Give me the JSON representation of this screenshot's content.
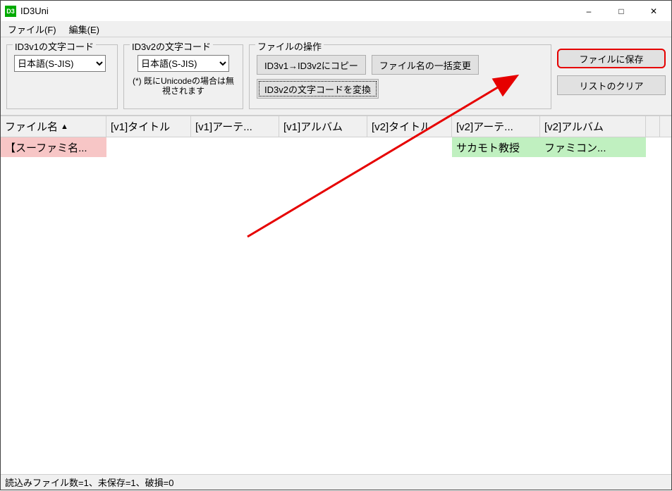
{
  "window": {
    "title": "ID3Uni",
    "icon_text": "D3"
  },
  "menu": {
    "file": "ファイル(F)",
    "edit": "編集(E)"
  },
  "groups": {
    "id3v1_label": "ID3v1の文字コード",
    "id3v2_label": "ID3v2の文字コード",
    "ops_label": "ファイルの操作"
  },
  "encodings": {
    "id3v1_selected": "日本語(S-JIS)",
    "id3v2_selected": "日本語(S-JIS)",
    "id3v2_note": "(*) 既にUnicodeの場合は無視されます"
  },
  "buttons": {
    "copy_v1_to_v2": "ID3v1→ID3v2にコピー",
    "batch_rename": "ファイル名の一括変更",
    "convert_v2_enc": "ID3v2の文字コードを変換",
    "save_to_file": "ファイルに保存",
    "clear_list": "リストのクリア"
  },
  "columns": [
    "ファイル名",
    "[v1]タイトル",
    "[v1]アーテ...",
    "[v1]アルバム",
    "[v2]タイトル",
    "[v2]アーテ...",
    "[v2]アルバム"
  ],
  "sort": {
    "col": 0,
    "dir": "asc",
    "indicator": "▲"
  },
  "rows": [
    {
      "filename": "【スーファミ名...",
      "v1_title": "",
      "v1_artist": "",
      "v1_album": "",
      "v2_title": "",
      "v2_artist": "サカモト教授",
      "v2_album": "ファミコン...",
      "filename_dirty": true,
      "v2_artist_dirty": true,
      "v2_album_dirty": true
    }
  ],
  "status": "読込みファイル数=1、未保存=1、破損=0",
  "colors": {
    "dirty_name": "#f7c6c6",
    "dirty_tag": "#c0f0c0",
    "highlight": "#e60000"
  }
}
